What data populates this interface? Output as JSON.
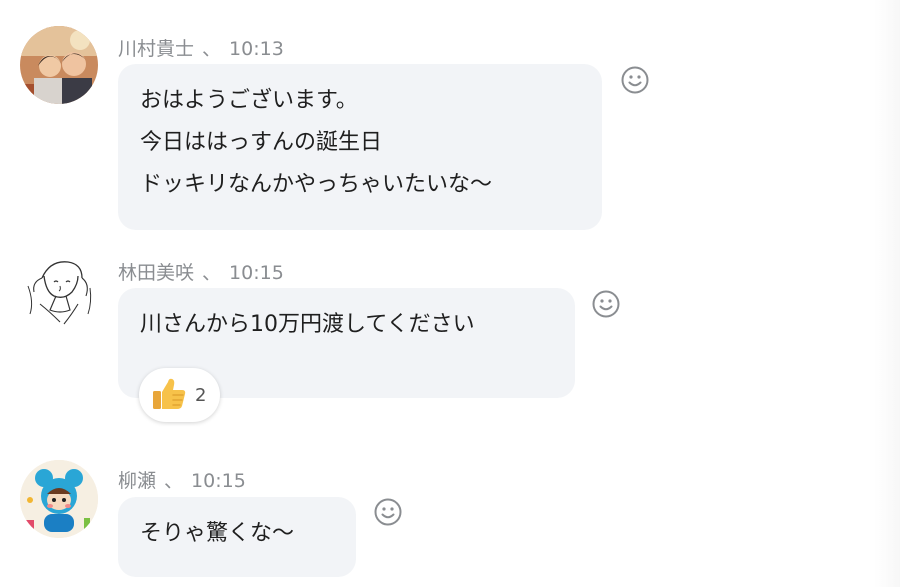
{
  "messages": [
    {
      "author": "川村貴士",
      "time": "10:13",
      "lines": [
        "おはようございます。",
        "今日ははっすんの誕生日",
        "ドッキリなんかやっちゃいたいな〜"
      ],
      "reactions": []
    },
    {
      "author": "林田美咲",
      "time": "10:15",
      "lines": [
        "川さんから10万円渡してください"
      ],
      "reactions": [
        {
          "icon": "thumbs-up-icon",
          "count": "2"
        }
      ]
    },
    {
      "author": "柳瀬",
      "time": "10:15",
      "lines": [
        "そりゃ驚くな〜"
      ],
      "reactions": []
    }
  ],
  "separator": "、",
  "colors": {
    "bubble": "#f2f4f7",
    "meta_text": "#8a8d91",
    "icon": "#8a8d91"
  }
}
